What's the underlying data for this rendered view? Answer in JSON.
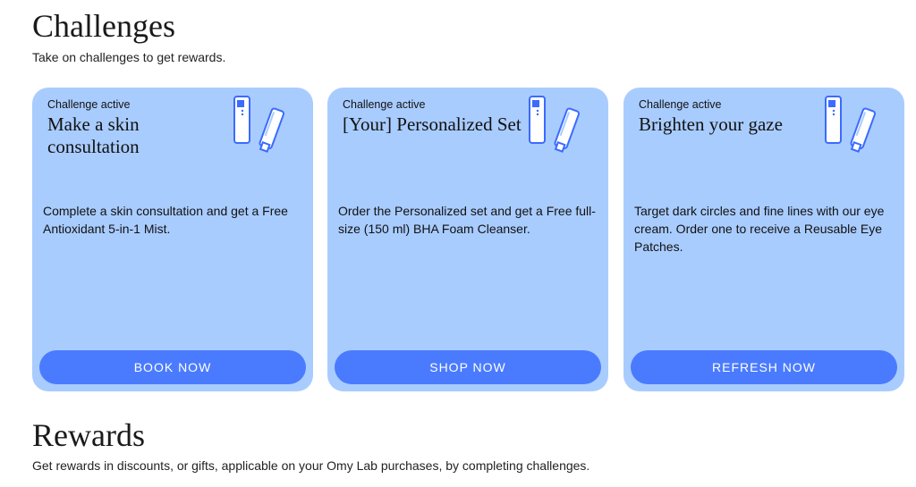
{
  "challenges": {
    "title": "Challenges",
    "subtitle": "Take on challenges to get rewards.",
    "cards": [
      {
        "status": "Challenge active",
        "title": "Make a skin consultation",
        "description": "Complete a skin consultation and get a Free Antioxidant 5-in-1 Mist.",
        "cta": "BOOK NOW",
        "icon": "skincare-products-icon"
      },
      {
        "status": "Challenge active",
        "title": "[Your] Personalized Set",
        "description": "Order the Personalized set and get a Free full-size (150 ml) BHA Foam Cleanser.",
        "cta": "SHOP NOW",
        "icon": "skincare-products-icon"
      },
      {
        "status": "Challenge active",
        "title": "Brighten your gaze",
        "description": "Target dark circles and fine lines with our eye cream. Order one to receive a Reusable Eye Patches.",
        "cta": "REFRESH NOW",
        "icon": "skincare-products-icon"
      }
    ]
  },
  "rewards": {
    "title": "Rewards",
    "subtitle": "Get rewards in discounts, or gifts, applicable on your Omy Lab purchases, by completing challenges."
  },
  "colors": {
    "card_background": "#a9ccff",
    "button": "#4a7bff",
    "button_text": "#ffffff",
    "icon_stroke": "#3b6bff"
  }
}
